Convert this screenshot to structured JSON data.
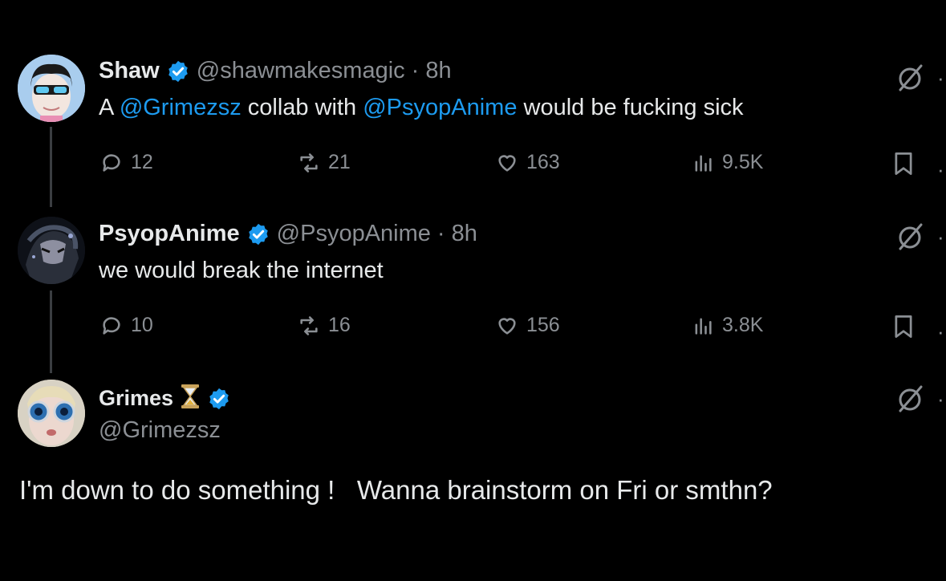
{
  "tweets": [
    {
      "name": "Shaw",
      "handle": "@shawmakesmagic",
      "sep": "·",
      "time": "8h",
      "text_parts": [
        "A ",
        "@Grimezsz",
        " collab with ",
        "@PsyopAnime",
        " would be fucking sick"
      ],
      "replies": "12",
      "reposts": "21",
      "likes": "163",
      "views": "9.5K"
    },
    {
      "name": "PsyopAnime",
      "handle": "@PsyopAnime",
      "sep": "·",
      "time": "8h",
      "text": "we would break the internet",
      "replies": "10",
      "reposts": "16",
      "likes": "156",
      "views": "3.8K"
    },
    {
      "name": "Grimes",
      "handle": "@Grimezsz",
      "text": "I'm down to do something !   Wanna brainstorm on Fri or smthn?"
    }
  ],
  "colors": {
    "background": "#000000",
    "text": "#e7e9ea",
    "muted": "#8b8f94",
    "link": "#1d9bf0",
    "verified": "#1d9bf0"
  },
  "icons": {
    "reply": "reply-icon",
    "repost": "repost-icon",
    "like": "heart-icon",
    "views": "views-icon",
    "bookmark": "bookmark-icon",
    "grok": "grok-icon",
    "verified": "verified-badge-icon",
    "hourglass": "hourglass-emoji"
  }
}
